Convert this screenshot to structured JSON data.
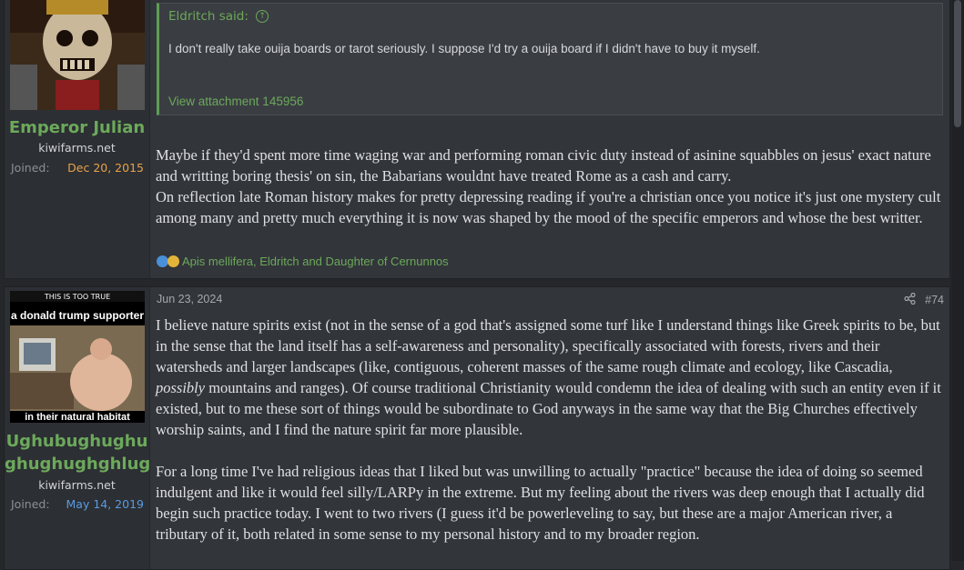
{
  "posts": [
    {
      "author": "Emperor Julian",
      "user_title": "kiwifarms.net",
      "joined_label": "Joined:",
      "joined_date": "Dec 20, 2015",
      "joined_color": "#e8a24a",
      "quote": {
        "author_line": "Eldritch said:",
        "text": "I don't really take ouija boards or tarot seriously. I suppose I'd try a ouija board if I didn't have to buy it myself.",
        "attachment_link": "View attachment 145956"
      },
      "body": [
        "Maybe if they'd spent more time waging war and performing roman civic duty instead of asinine squabbles on jesus' exact nature and writting boring thesis' on sin, the Babarians wouldnt have treated Rome as a cash and carry.",
        "On reflection late Roman history makes for pretty depressing reading if you're a christian once you notice it's just one mystery cult among many and pretty much everything it is now was shaped by the mood of the specific emperors and whose the best writter."
      ],
      "reactions": "Apis mellifera, Eldritch and Daughter of Cernunnos"
    },
    {
      "author_line1": "Ughubughughu",
      "author_line2": "ghughughghlug",
      "user_title": "kiwifarms.net",
      "joined_label": "Joined:",
      "joined_date": "May 14, 2019",
      "joined_color": "#5a9be0",
      "date": "Jun 23, 2024",
      "post_number": "#74",
      "avatar_top_text": "THIS IS TOO TRUE",
      "avatar_caption": "a donald trump supporter",
      "avatar_bottom_text": "in their natural habitat",
      "body_p1_a": "I believe nature spirits exist (not in the sense of a god that's assigned some turf like I understand things like Greek spirits to be, but in the sense that the land itself has a self-awareness and personality), specifically associated with forests, rivers and their watersheds and larger landscapes (like, contiguous, coherent masses of the same rough climate and ecology, like Cascadia, ",
      "body_p1_em": "possibly",
      "body_p1_b": " mountains and ranges). Of course traditional Christianity would condemn the idea of dealing with such an entity even if it existed, but to me these sort of things would be subordinate to God anyways in the same way that the Big Churches effectively worship saints, and I find the nature spirit far more plausible.",
      "body_p2": "For a long time I've had religious ideas that I liked but was unwilling to actually \"practice\" because the idea of doing so seemed indulgent and like it would feel silly/LARPy in the extreme. But my feeling about the rivers was deep enough that I actually did begin such practice today. I went to two rivers (I guess it'd be powerleveling to say, but these are a major American river, a tributary of it, both related in some sense to my personal history and to my broader region."
    }
  ],
  "colors": {
    "accent_green": "#6ca95b",
    "post_bg": "#32353a",
    "page_bg": "#25272b"
  }
}
